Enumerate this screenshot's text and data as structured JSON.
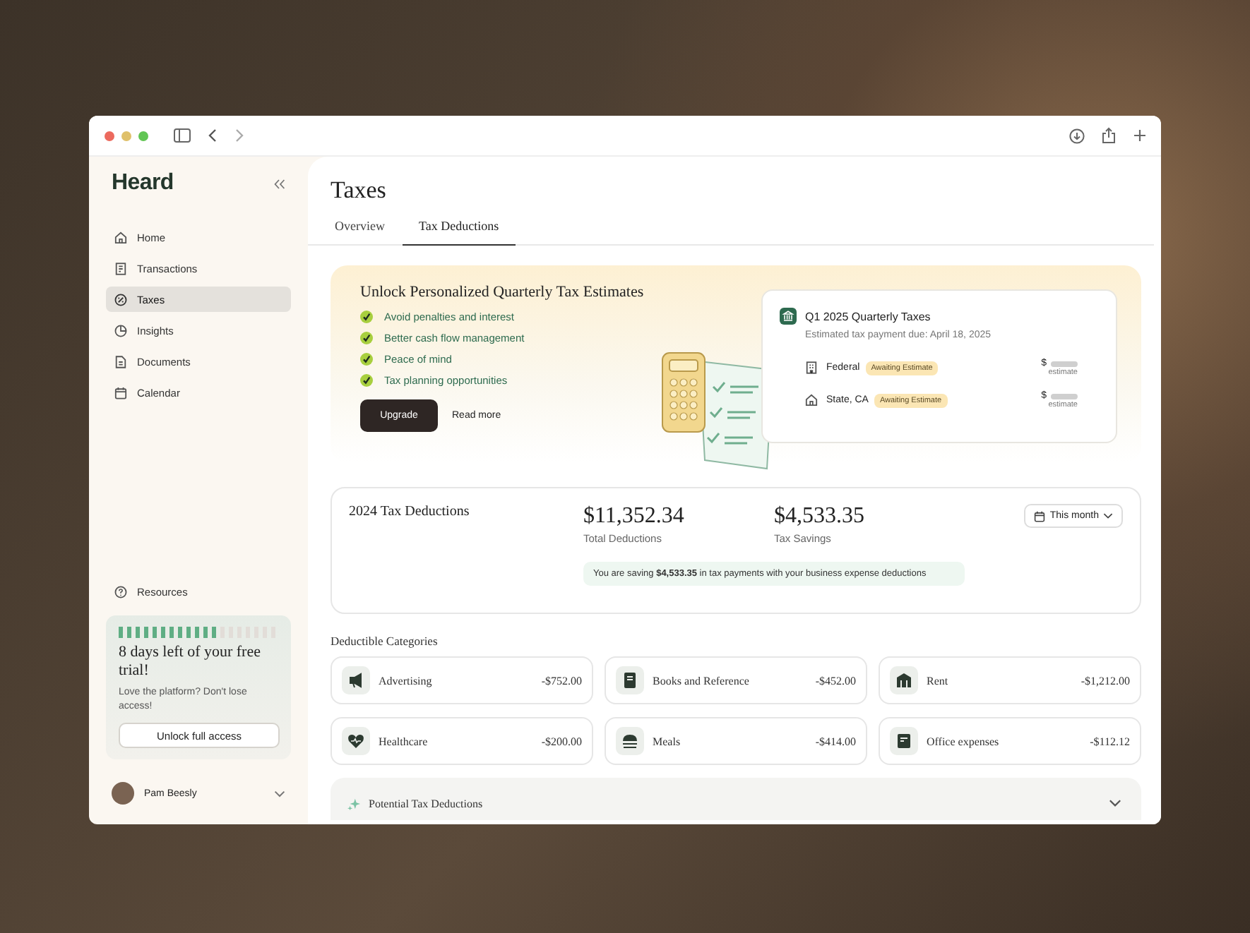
{
  "sidebar": {
    "logo": "Heard",
    "items": [
      {
        "kind": "home",
        "label": "Home",
        "selected": false
      },
      {
        "kind": "transactions",
        "label": "Transactions",
        "selected": false
      },
      {
        "kind": "taxes",
        "label": "Taxes",
        "selected": true
      },
      {
        "kind": "insights",
        "label": "Insights",
        "selected": false
      },
      {
        "kind": "documents",
        "label": "Documents",
        "selected": false
      },
      {
        "kind": "calendar",
        "label": "Calendar",
        "selected": false
      }
    ],
    "resources": "Resources",
    "trial": {
      "level": 0.625,
      "title": "8 days left of your free trial!",
      "text": "Love the platform? Don't lose access!",
      "button": "Unlock full access"
    },
    "user": {
      "name": "Pam Beesly"
    }
  },
  "page": {
    "title": "Taxes",
    "tabs": [
      {
        "label": "Overview",
        "selected": false
      },
      {
        "label": "Tax Deductions",
        "selected": true
      }
    ]
  },
  "banner": {
    "title": "Unlock Personalized Quarterly Tax Estimates",
    "benefits": [
      "Avoid penalties and interest",
      "Better cash flow management",
      "Peace of mind",
      "Tax planning opportunities"
    ],
    "primary_button": "Upgrade",
    "link": "Read more",
    "card": {
      "title": "Q1 2025 Quarterly Taxes",
      "subtitle": "Estimated tax payment due: April 18, 2025",
      "rows": [
        {
          "kind": "federal",
          "label": "Federal",
          "badge": "Awaiting Estimate",
          "currency": "$",
          "note": "estimate"
        },
        {
          "kind": "state",
          "label": "State, CA",
          "badge": "Awaiting Estimate",
          "currency": "$",
          "note": "estimate"
        }
      ]
    }
  },
  "summary": {
    "title": "2024 Tax Deductions",
    "stats": [
      {
        "value": "$11,352.34",
        "label": "Total Deductions"
      },
      {
        "value": "$4,533.35",
        "label": "Tax Savings"
      }
    ],
    "period": "This month",
    "message": "You are saving **$4,533.35** in tax payments with your business expense deductions"
  },
  "categories": {
    "title": "Deductible Categories",
    "items": [
      {
        "kind": "advertising",
        "name": "Advertising",
        "amount": "-$752.00"
      },
      {
        "kind": "books",
        "name": "Books and Reference",
        "amount": "-$452.00"
      },
      {
        "kind": "rent",
        "name": "Rent",
        "amount": "-$1,212.00"
      },
      {
        "kind": "health",
        "name": "Healthcare",
        "amount": "-$200.00"
      },
      {
        "kind": "meals",
        "name": "Meals",
        "amount": "-$414.00"
      },
      {
        "kind": "office",
        "name": "Office expenses",
        "amount": "-$112.12"
      }
    ]
  },
  "potential": {
    "title": "Potential Tax Deductions",
    "expanded": false
  }
}
